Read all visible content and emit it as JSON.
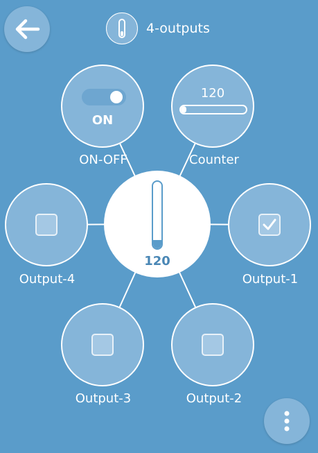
{
  "header": {
    "title": "4-outputs",
    "icon": "thermometer-icon"
  },
  "colors": {
    "background": "#5a9cca",
    "node_fill": "#85b5d9",
    "accent": "#4a87b5"
  },
  "center": {
    "value": "120",
    "gauge_fraction": 0.12
  },
  "nodes": {
    "on_off": {
      "label": "ON-OFF",
      "state_text": "ON",
      "switch_on": true
    },
    "counter": {
      "label": "Counter",
      "value": "120",
      "progress_fraction": 0.08
    },
    "output_1": {
      "label": "Output-1",
      "checked": true
    },
    "output_2": {
      "label": "Output-2",
      "checked": false
    },
    "output_3": {
      "label": "Output-3",
      "checked": false
    },
    "output_4": {
      "label": "Output-4",
      "checked": false
    }
  },
  "buttons": {
    "back_icon": "arrow-left-icon",
    "menu_icon": "more-vertical-icon"
  }
}
